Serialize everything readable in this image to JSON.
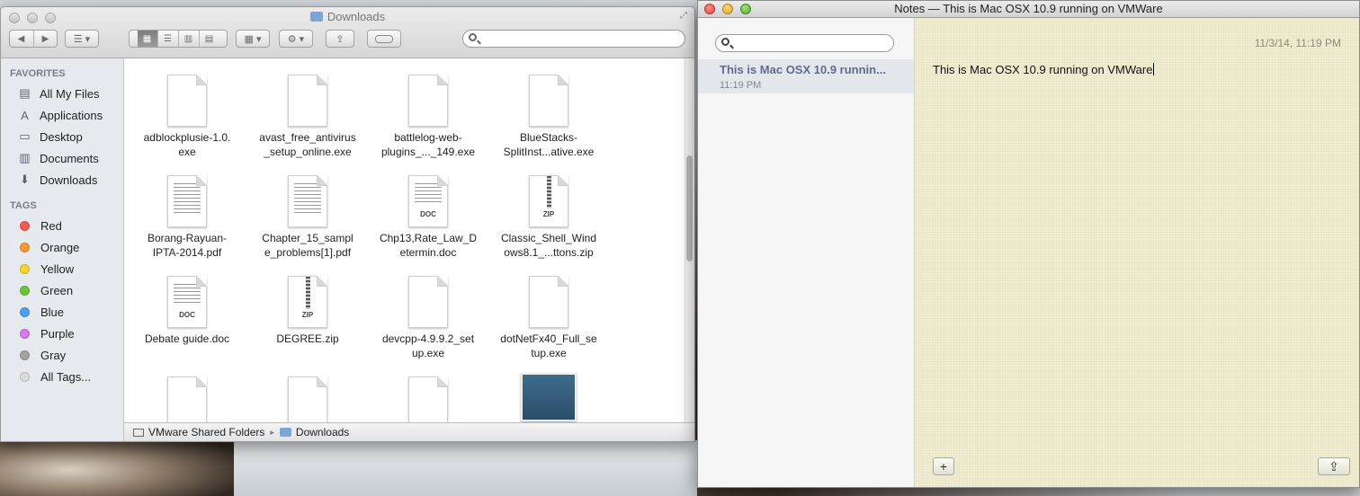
{
  "finder": {
    "title": "Downloads",
    "sidebar": {
      "favorites_heading": "FAVORITES",
      "favorites": [
        {
          "label": "All My Files",
          "icon": "all-files-icon"
        },
        {
          "label": "Applications",
          "icon": "applications-icon"
        },
        {
          "label": "Desktop",
          "icon": "desktop-icon"
        },
        {
          "label": "Documents",
          "icon": "documents-icon"
        },
        {
          "label": "Downloads",
          "icon": "downloads-icon"
        }
      ],
      "tags_heading": "TAGS",
      "tags": [
        {
          "label": "Red",
          "color": "#f25a55"
        },
        {
          "label": "Orange",
          "color": "#f59a32"
        },
        {
          "label": "Yellow",
          "color": "#f2d32a"
        },
        {
          "label": "Green",
          "color": "#6cc43c"
        },
        {
          "label": "Blue",
          "color": "#4ea0ef"
        },
        {
          "label": "Purple",
          "color": "#d57ae8"
        },
        {
          "label": "Gray",
          "color": "#a3a3a3"
        },
        {
          "label": "All Tags...",
          "color": "#dcdcdc"
        }
      ]
    },
    "files": [
      {
        "line1": "adblockplusie-1.0.",
        "line2": "exe",
        "kind": "blank"
      },
      {
        "line1": "avast_free_antivirus",
        "line2": "_setup_online.exe",
        "kind": "blank"
      },
      {
        "line1": "battlelog-web-",
        "line2": "plugins_..._149.exe",
        "kind": "blank"
      },
      {
        "line1": "BlueStacks-",
        "line2": "SplitInst...ative.exe",
        "kind": "blank"
      },
      {
        "line1": "Borang-Rayuan-",
        "line2": "IPTA-2014.pdf",
        "kind": "pdf"
      },
      {
        "line1": "Chapter_15_sampl",
        "line2": "e_problems[1].pdf",
        "kind": "pdf"
      },
      {
        "line1": "Chp13,Rate_Law_D",
        "line2": "etermin.doc",
        "kind": "doc",
        "badge": "DOC"
      },
      {
        "line1": "Classic_Shell_Wind",
        "line2": "ows8.1_...ttons.zip",
        "kind": "zip",
        "badge": "ZIP"
      },
      {
        "line1": "Debate guide.doc",
        "line2": "",
        "kind": "doc",
        "badge": "DOC"
      },
      {
        "line1": "DEGREE.zip",
        "line2": "",
        "kind": "zip",
        "badge": "ZIP"
      },
      {
        "line1": "devcpp-4.9.9.2_set",
        "line2": "up.exe",
        "kind": "blank"
      },
      {
        "line1": "dotNetFx40_Full_se",
        "line2": "tup.exe",
        "kind": "blank"
      }
    ],
    "path": {
      "root": "VMware Shared Folders",
      "sep": "▸",
      "current": "Downloads"
    }
  },
  "notes": {
    "window_title": "Notes — This is Mac OSX 10.9 running on VMWare",
    "list": [
      {
        "title": "This is Mac OSX 10.9 runnin...",
        "time": "11:19 PM"
      }
    ],
    "editor": {
      "date": "11/3/14, 11:19 PM",
      "text": "This is Mac OSX 10.9 running on VMWare"
    },
    "add_label": "+",
    "share_label": "⇪"
  }
}
